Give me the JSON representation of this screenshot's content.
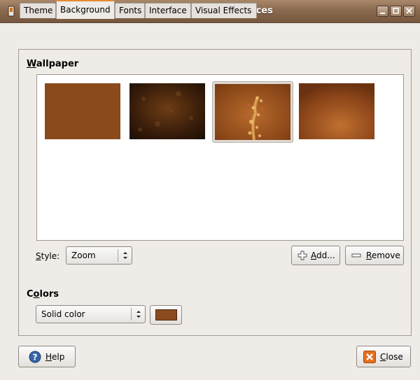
{
  "window": {
    "title": "Appearance Preferences"
  },
  "tabs": [
    {
      "label": "Theme"
    },
    {
      "label": "Background"
    },
    {
      "label": "Fonts"
    },
    {
      "label": "Interface"
    },
    {
      "label": "Visual Effects"
    }
  ],
  "active_tab": "Background",
  "wallpaper": {
    "section_label": "Wallpaper",
    "section_mnemonic": "W",
    "section_rest": "allpaper",
    "selected_index": 2,
    "thumbnails": [
      "solid-brown",
      "dark-textured-brown",
      "ubuntu-logo-brown",
      "radial-brown"
    ]
  },
  "style": {
    "label_mnemonic": "S",
    "label_rest": "tyle:",
    "value": "Zoom"
  },
  "buttons": {
    "add_mnemonic": "A",
    "add_rest": "dd...",
    "remove_pre": "",
    "remove_mnemonic": "R",
    "remove_rest": "emove",
    "help_mnemonic": "H",
    "help_rest": "elp",
    "close_mnemonic": "C",
    "close_rest": "lose"
  },
  "colors": {
    "section_pre": "C",
    "section_mnemonic": "o",
    "section_rest": "lors",
    "mode": "Solid color",
    "swatch_color": "#8a4a1d"
  },
  "icons": {
    "app": "appearance-icon",
    "add": "plus-icon",
    "remove": "minus-icon",
    "help": "help-icon",
    "close": "close-icon"
  }
}
